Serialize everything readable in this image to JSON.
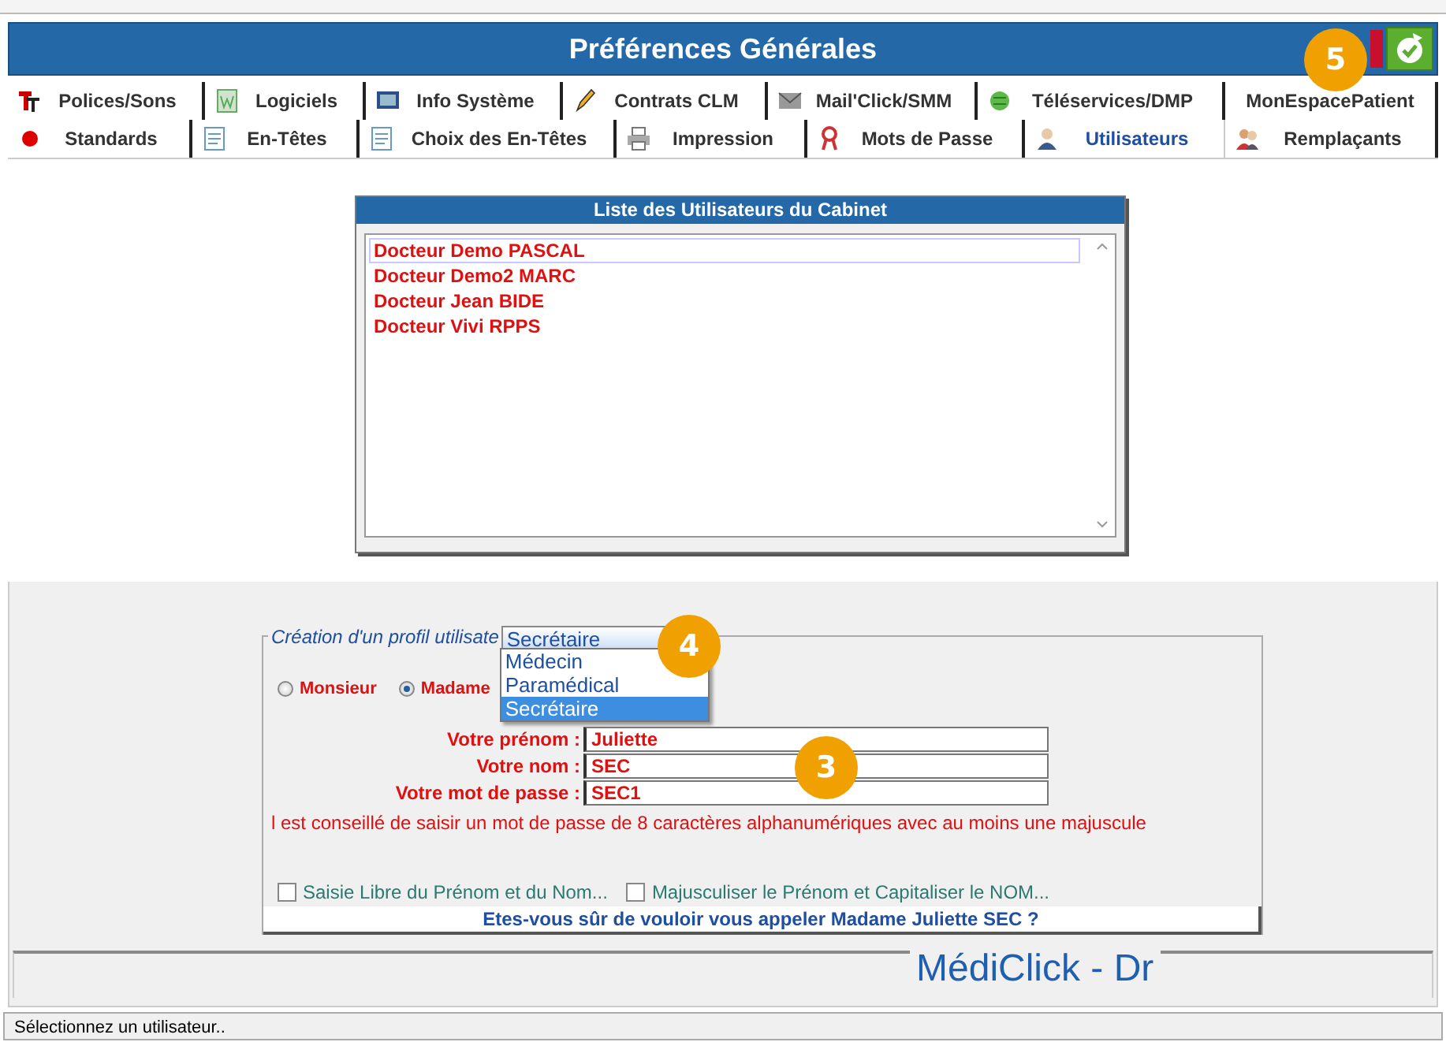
{
  "window": {
    "title": "Préférences Générales"
  },
  "tab_rows": [
    {
      "tabs": [
        {
          "label": "Polices/Sons",
          "selected": false
        },
        {
          "label": "Logiciels",
          "selected": false
        },
        {
          "label": "Info Système",
          "selected": false
        },
        {
          "label": "Contrats CLM",
          "selected": false
        },
        {
          "label": "Mail'Click/SMM",
          "selected": false
        },
        {
          "label": "Téléservices/DMP",
          "selected": false
        },
        {
          "label": "MonEspacePatient",
          "selected": false
        }
      ]
    },
    {
      "tabs": [
        {
          "label": "Standards",
          "selected": false
        },
        {
          "label": "En-Têtes",
          "selected": false
        },
        {
          "label": "Choix des En-Têtes",
          "selected": false
        },
        {
          "label": "Impression",
          "selected": false
        },
        {
          "label": "Mots de Passe",
          "selected": false
        },
        {
          "label": "Utilisateurs",
          "selected": true
        },
        {
          "label": "Remplaçants",
          "selected": false
        }
      ]
    }
  ],
  "user_list": {
    "title": "Liste des Utilisateurs du Cabinet",
    "items": [
      {
        "label": "Docteur Demo PASCAL",
        "selected": true
      },
      {
        "label": "Docteur Demo2 MARC",
        "selected": false
      },
      {
        "label": "Docteur Jean BIDE",
        "selected": false
      },
      {
        "label": "Docteur Vivi RPPS",
        "selected": false
      }
    ]
  },
  "profile": {
    "legend": "Création d'un profil utilisate",
    "profile_type": {
      "value": "Secrétaire",
      "options": [
        {
          "label": "Médecin",
          "selected": false
        },
        {
          "label": "Paramédical",
          "selected": false
        },
        {
          "label": "Secrétaire",
          "selected": true
        }
      ]
    },
    "civility": [
      {
        "label": "Monsieur",
        "selected": false
      },
      {
        "label": "Madame",
        "selected": true
      }
    ],
    "fields": [
      {
        "label": "Votre prénom :",
        "value": "Juliette"
      },
      {
        "label": "Votre nom :",
        "value": "SEC"
      },
      {
        "label": "Votre mot de passe :",
        "value": "SEC1"
      }
    ],
    "warning": "l est conseillé de saisir un mot de passe de 8 caractères alphanumériques avec au moins une majuscule",
    "checkboxes": [
      {
        "label": "Saisie Libre du Prénom et du Nom...",
        "checked": false
      },
      {
        "label": "Majusculiser le Prénom et Capitaliser le NOM...",
        "checked": false
      }
    ],
    "confirmation": "Etes-vous sûr de vouloir vous appeler Madame Juliette SEC ?"
  },
  "brand": "MédiClick - Dr",
  "status_bar": "Sélectionnez un utilisateur..",
  "callouts": [
    {
      "label": "5"
    },
    {
      "label": "4"
    },
    {
      "label": "3"
    }
  ]
}
